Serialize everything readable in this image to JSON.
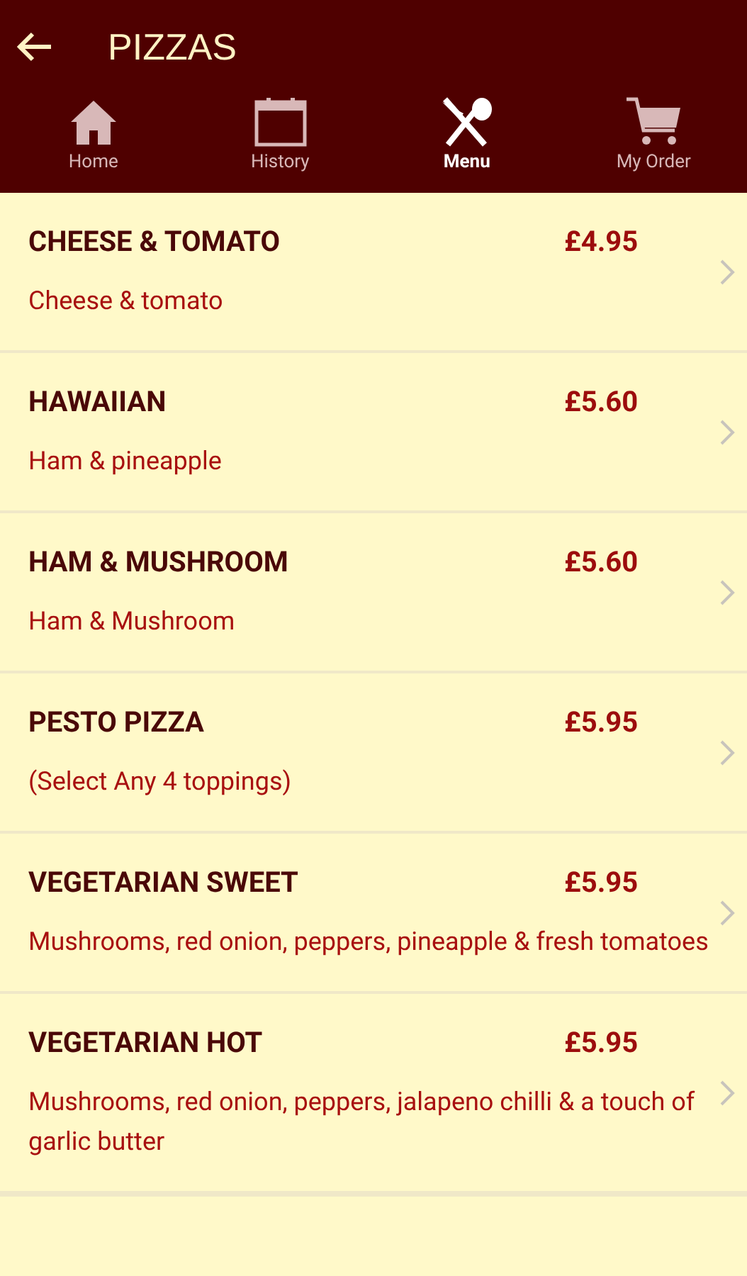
{
  "app_bar": {
    "title": "PIZZAS"
  },
  "tabs": [
    {
      "label": "Home",
      "kind": "home",
      "selected": false
    },
    {
      "label": "History",
      "kind": "history",
      "selected": false
    },
    {
      "label": "Menu",
      "kind": "menu",
      "selected": true
    },
    {
      "label": "My Order",
      "kind": "order",
      "selected": false
    }
  ],
  "items": [
    {
      "name": "CHEESE & TOMATO",
      "price": "£4.95",
      "description": "Cheese & tomato"
    },
    {
      "name": "HAWAIIAN",
      "price": "£5.60",
      "description": "Ham & pineapple"
    },
    {
      "name": "HAM & MUSHROOM",
      "price": "£5.60",
      "description": "Ham & Mushroom"
    },
    {
      "name": "PESTO PIZZA",
      "price": "£5.95",
      "description": "(Select Any 4 toppings)"
    },
    {
      "name": "VEGETARIAN SWEET",
      "price": "£5.95",
      "description": "Mushrooms, red onion, peppers,  pineapple & fresh tomatoes"
    },
    {
      "name": "VEGETARIAN HOT",
      "price": "£5.95",
      "description": "Mushrooms, red onion, peppers,  jalapeno chilli & a touch of garlic butter"
    }
  ]
}
